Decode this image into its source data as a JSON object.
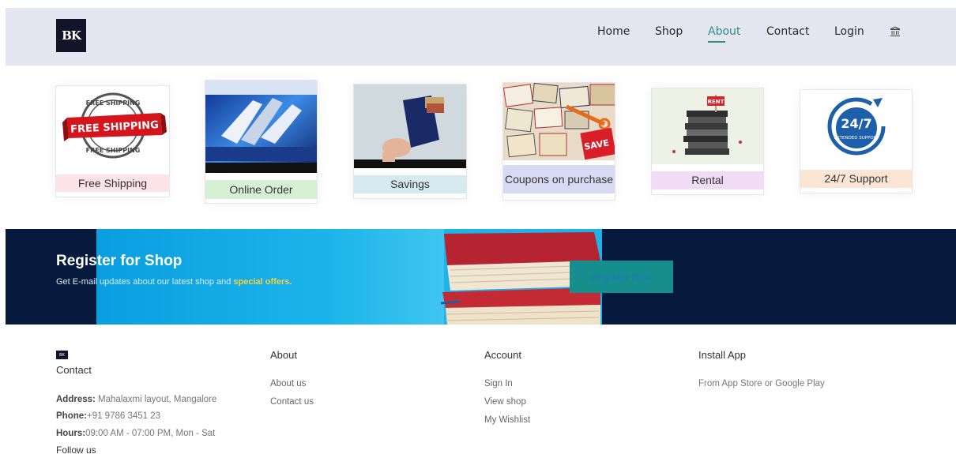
{
  "header": {
    "logo_text": "BK",
    "nav": [
      {
        "label": "Home"
      },
      {
        "label": "Shop"
      },
      {
        "label": "About"
      },
      {
        "label": "Contact"
      },
      {
        "label": "Login"
      }
    ],
    "active_nav": "About",
    "bank_icon": "bank-icon"
  },
  "features": [
    {
      "label": "Free Shipping",
      "label_bg": "#fbe3e7",
      "image_text": "FREE SHIPPING",
      "image_icon": "free-shipping-stamp"
    },
    {
      "label": "Online Order",
      "label_bg": "#d5f0d4",
      "image_icon": "online-order-image"
    },
    {
      "label": "Savings",
      "label_bg": "#d5e9f0",
      "image_icon": "savings-wallet-image"
    },
    {
      "label": "Coupons on purchase",
      "label_bg": "#d8daf4",
      "image_icon": "coupons-image"
    },
    {
      "label": "Rental",
      "label_bg": "#f0dcf4",
      "image_icon": "rental-books-image",
      "image_text": "RENT"
    },
    {
      "label": "24/7 Support",
      "label_bg": "#fbe6d6",
      "image_icon": "support-24-7-image",
      "image_text": "24/7",
      "image_subtext": "EXTENDED SUPPORT"
    }
  ],
  "banner": {
    "title": "Register for Shop",
    "subtitle_pre": "Get E-mail updates about our latest shop and ",
    "subtitle_highlight": "special offers.",
    "button": "Register Now"
  },
  "footer": {
    "logo_text": "BK",
    "contact_title": "Contact",
    "address_label": "Address:",
    "address": " Mahalaxmi layout, Mangalore",
    "phone_label": "Phone:",
    "phone": "+91 9786 3451 23",
    "hours_label": "Hours:",
    "hours": "09:00 AM - 07:00 PM, Mon - Sat",
    "follow": "Follow us",
    "about_title": "About",
    "about_links": [
      "About us",
      "Contact us"
    ],
    "account_title": "Account",
    "account_links": [
      "Sign In",
      "View shop",
      "My Wishlist"
    ],
    "install_title": "Install App",
    "install_text": "From App Store or Google Play"
  },
  "colors": {
    "header_bg": "#e4e6f2",
    "accent": "#2f8e82",
    "banner_bg": "#061a3e",
    "highlight": "#f3d247"
  }
}
